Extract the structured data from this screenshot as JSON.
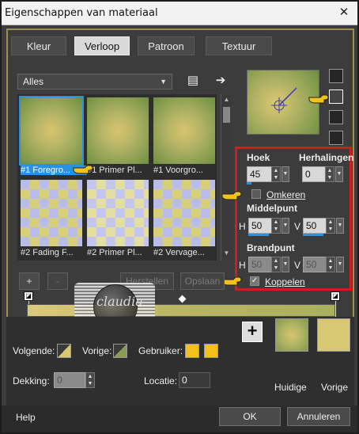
{
  "window": {
    "title": "Eigenschappen van materiaal"
  },
  "tabs": [
    {
      "label": "Kleur"
    },
    {
      "label": "Verloop"
    },
    {
      "label": "Patroon"
    },
    {
      "label": "Textuur"
    }
  ],
  "category": {
    "selected": "Alles"
  },
  "gradients": [
    {
      "label": "#1 Foregro..."
    },
    {
      "label": "#1 Primer Pl..."
    },
    {
      "label": "#1 Voorgro..."
    },
    {
      "label": "#2 Fading F..."
    },
    {
      "label": "#2 Primer Pl..."
    },
    {
      "label": "#2 Vervage..."
    }
  ],
  "props": {
    "hoek_label": "Hoek",
    "hoek_value": "45",
    "herhalingen_label": "Herhalingen",
    "herhalingen_value": "0",
    "omkeren_label": "Omkeren",
    "middelpunt_label": "Middelpunt",
    "h_label": "H",
    "v_label": "V",
    "middel_h": "50",
    "middel_v": "50",
    "brandpunt_label": "Brandpunt",
    "brand_h": "50",
    "brand_v": "50",
    "koppelen_label": "Koppelen"
  },
  "buttons": {
    "add": "+",
    "remove": "-",
    "herstellen": "Herstellen",
    "opslaan": "Opslaan"
  },
  "watermark": {
    "text": "claudia"
  },
  "bottom": {
    "volgende": "Volgende:",
    "vorige": "Vorige:",
    "gebruiker": "Gebruiker:",
    "dekking": "Dekking:",
    "dekking_value": "0",
    "locatie": "Locatie:",
    "locatie_value": "0",
    "huidige": "Huidige",
    "vorige_swatch": "Vorige"
  },
  "footer": {
    "help": "Help",
    "ok": "OK",
    "cancel": "Annuleren"
  },
  "colors": {
    "accent": "#2a90e0",
    "highlight_frame": "#d21d1d",
    "swatch_yellow": "#f2c21b",
    "swatch_current": "#b5b96a",
    "swatch_previous": "#d8c874"
  }
}
